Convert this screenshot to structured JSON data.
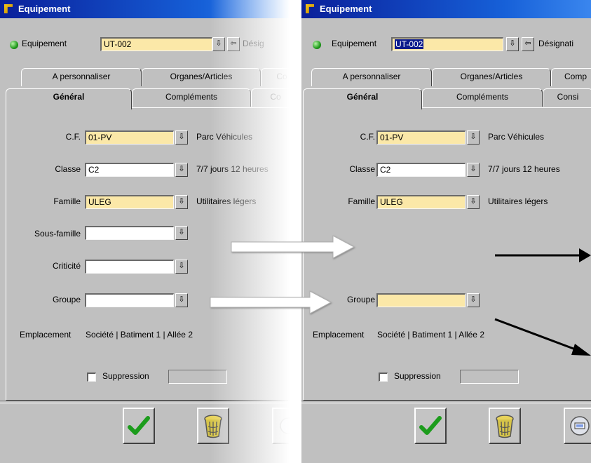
{
  "window": {
    "title": "Equipement"
  },
  "header": {
    "label": "Equipement",
    "value": "UT-002",
    "designation_left": "Désig",
    "designation_right": "Désignati"
  },
  "tabs_back": {
    "left": [
      "A personnaliser",
      "Organes/Articles",
      "Co"
    ],
    "right": [
      "A personnaliser",
      "Organes/Articles",
      "Comp"
    ]
  },
  "tabs_front": {
    "left": [
      "Général",
      "Compléments",
      "Co"
    ],
    "right": [
      "Général",
      "Compléments",
      "Consi"
    ]
  },
  "form": {
    "cf": {
      "label": "C.F.",
      "value": "01-PV",
      "desc": "Parc Véhicules"
    },
    "classe": {
      "label": "Classe",
      "value": "C2",
      "desc": "7/7 jours 12 heures"
    },
    "famille": {
      "label": "Famille",
      "value": "ULEG",
      "desc": "Utilitaires légers"
    },
    "sous_famille": {
      "label": "Sous-famille",
      "value": ""
    },
    "criticite": {
      "label": "Criticité",
      "value": ""
    },
    "groupe": {
      "label": "Groupe",
      "value": ""
    },
    "emplacement": {
      "label": "Emplacement",
      "value": "Société | Batiment 1 | Allée 2"
    },
    "suppression": {
      "label": "Suppression"
    }
  },
  "icons": {
    "dropdown": "⇩",
    "back": "⇦",
    "validate": "check-icon",
    "delete": "trash-icon",
    "print": "printer-icon"
  },
  "colors": {
    "window_bg": "#c0c0c0",
    "title_bar": "#0a1f9a",
    "field_yellow": "#fbe8a8",
    "selection": "#0b1a8c",
    "check_green": "#1c9c1c"
  }
}
